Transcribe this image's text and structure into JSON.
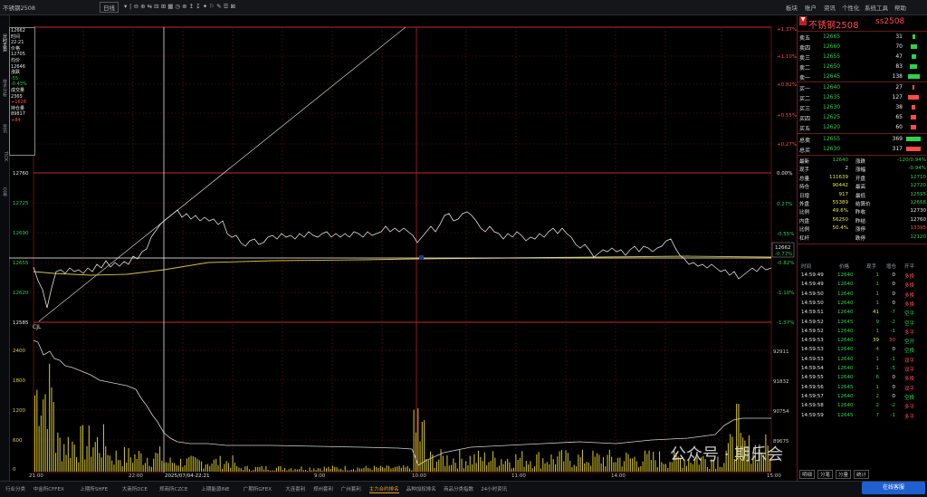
{
  "toolbar": {
    "contract_label": "不锈钢2508",
    "period_label": "日线",
    "right_menu": [
      "板块",
      "账户",
      "资讯",
      "个性化",
      "系统工具",
      "帮助"
    ]
  },
  "chart": {
    "price_axis": [
      "12760",
      "12725",
      "12690",
      "12655",
      "12620",
      "12585"
    ],
    "pct_axis_top": [
      "+1.37%",
      "+1.10%",
      "+0.82%",
      "+0.55%",
      "+0.27%"
    ],
    "pct_axis": [
      "0.00%",
      "0.27%",
      "-0.55%",
      "-0.82%",
      "-1.10%",
      "-1.37%"
    ],
    "last_price_tag": "12662",
    "last_pct_tag": "-0.77%",
    "vol_axis": [
      "2400",
      "1800",
      "1200",
      "600",
      "0"
    ],
    "oi_axis": [
      "92911",
      "91832",
      "90754",
      "89675"
    ],
    "time_axis": [
      "21:00",
      "22:00",
      "9:00",
      "10:00",
      "11:00",
      "14:00",
      "15:00"
    ],
    "cursor_time": "2025/07/04-22:21",
    "vol_label": "CJL"
  },
  "infobox": {
    "lines": [
      "12662",
      "时间",
      "22:21",
      "价格",
      "12705",
      "均价",
      "12646",
      "涨跌",
      "-55",
      "-0.43%",
      "成交量",
      "2365",
      "+1628",
      "持仓量",
      "89817",
      "+84"
    ]
  },
  "quote": {
    "name": "不锈钢2508",
    "code": "ss2508",
    "asks": [
      {
        "label": "卖五",
        "price": "12665",
        "vol": "31"
      },
      {
        "label": "卖四",
        "price": "12660",
        "vol": "70"
      },
      {
        "label": "卖三",
        "price": "12655",
        "vol": "47"
      },
      {
        "label": "卖二",
        "price": "12650",
        "vol": "83"
      },
      {
        "label": "卖一",
        "price": "12645",
        "vol": "138"
      }
    ],
    "bids": [
      {
        "label": "买一",
        "price": "12640",
        "vol": "27"
      },
      {
        "label": "买二",
        "price": "12635",
        "vol": "127"
      },
      {
        "label": "买三",
        "price": "12630",
        "vol": "38"
      },
      {
        "label": "买四",
        "price": "12625",
        "vol": "65"
      },
      {
        "label": "买五",
        "price": "12620",
        "vol": "60"
      }
    ],
    "total_sell": {
      "label": "总卖",
      "price": "12655",
      "vol": "369"
    },
    "total_buy": {
      "label": "总买",
      "price": "12630",
      "vol": "317"
    },
    "stats": [
      {
        "l1": "最新",
        "v1": "12640",
        "l2": "涨跌",
        "v2": "-120/0.94%"
      },
      {
        "l1": "现手",
        "v1": "2",
        "l2": "涨幅",
        "v2": "-0.94%"
      },
      {
        "l1": "总量",
        "v1": "111639",
        "l2": "开盘",
        "v2": "12710"
      },
      {
        "l1": "持仓",
        "v1": "90442",
        "l2": "最高",
        "v2": "12720"
      },
      {
        "l1": "日增",
        "v1": "917",
        "l2": "最低",
        "v2": "12595"
      },
      {
        "l1": "外盘",
        "v1": "55389",
        "l2": "结算价",
        "v2": "12668"
      },
      {
        "l1": "比例",
        "v1": "49.6%",
        "l2": "昨收",
        "v2": "12730"
      },
      {
        "l1": "内盘",
        "v1": "56250",
        "l2": "昨结",
        "v2": "12760"
      },
      {
        "l1": "比例",
        "v1": "50.4%",
        "l2": "涨停",
        "v2": "13395"
      },
      {
        "l1": "杠杆",
        "v1": "",
        "l2": "跌停",
        "v2": "12120"
      }
    ],
    "tick_headers": [
      "时间",
      "价格",
      "现手",
      "增仓",
      "开平"
    ],
    "ticks": [
      [
        "14:59:49",
        "12640",
        "1",
        "0",
        "多换"
      ],
      [
        "14:59:49",
        "12640",
        "1",
        "0",
        "多换"
      ],
      [
        "14:59:50",
        "12640",
        "1",
        "0",
        "多换"
      ],
      [
        "14:59:50",
        "12640",
        "1",
        "0",
        "多换"
      ],
      [
        "14:59:51",
        "12640",
        "41",
        "-7",
        "空平"
      ],
      [
        "14:59:52",
        "12645",
        "9",
        "-2",
        "空平"
      ],
      [
        "14:59:52",
        "12640",
        "1",
        "-1",
        "多平"
      ],
      [
        "14:59:53",
        "12640",
        "39",
        "30",
        "空开"
      ],
      [
        "14:59:53",
        "12640",
        "4",
        "0",
        "空换"
      ],
      [
        "14:59:53",
        "12640",
        "1",
        "-1",
        "双平"
      ],
      [
        "14:59:54",
        "12640",
        "1",
        "-5",
        "双平"
      ],
      [
        "14:59:55",
        "12640",
        "6",
        "0",
        "多换"
      ],
      [
        "14:59:56",
        "12645",
        "1",
        "0",
        "双平"
      ],
      [
        "14:59:57",
        "12640",
        "2",
        "0",
        "空换"
      ],
      [
        "14:59:58",
        "12640",
        "2",
        "-2",
        "多平"
      ],
      [
        "14:59:59",
        "12645",
        "7",
        "-1",
        "多平"
      ]
    ],
    "bottom_tabs": [
      "明细",
      "分笔",
      "分量",
      "统计"
    ]
  },
  "bottom_tabs": [
    "行业分类",
    "中金所CFFEX",
    "上期所SHFE",
    "大商所DCE",
    "郑商所CZCE",
    "上期能源INE",
    "广期所GFEX",
    "大连套利",
    "郑州套利",
    "广州套利",
    "主力合约排名",
    "品种加权排名",
    "商品分类指数",
    "24小时资讯"
  ],
  "bottom_active": "主力合约排名",
  "watermark": "公众号 · 期乐会",
  "online_label": "在线客服",
  "side_tabs": [
    "分时走势",
    "技术分析",
    "资讯",
    "TICK",
    "交易"
  ]
}
